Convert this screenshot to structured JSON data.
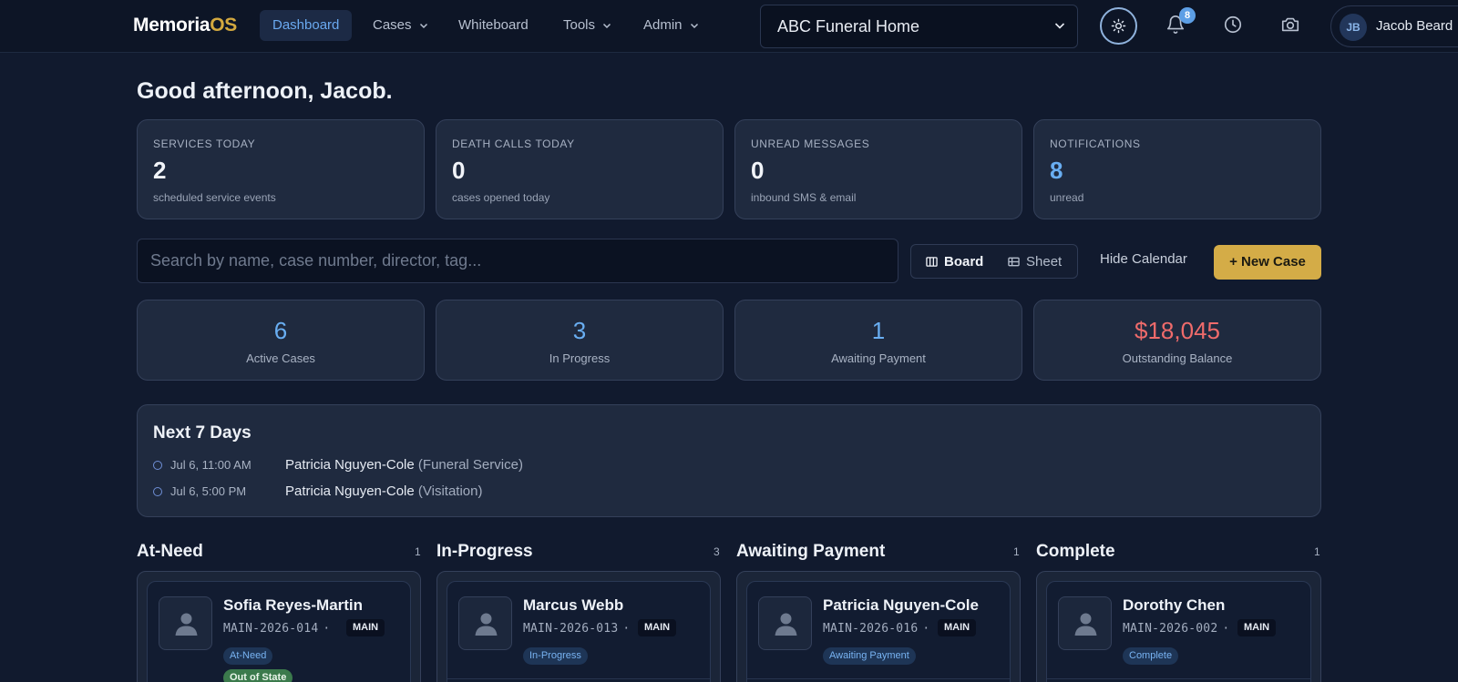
{
  "app": {
    "logo_part1": "Memoria",
    "logo_part2": "OS"
  },
  "nav": {
    "items": [
      {
        "label": "Dashboard",
        "active": true,
        "dropdown": false
      },
      {
        "label": "Cases",
        "active": false,
        "dropdown": true
      },
      {
        "label": "Whiteboard",
        "active": false,
        "dropdown": false
      },
      {
        "label": "Tools",
        "active": false,
        "dropdown": true
      },
      {
        "label": "Admin",
        "active": false,
        "dropdown": true
      }
    ]
  },
  "location_select": {
    "value": "ABC Funeral Home"
  },
  "header": {
    "notification_count": "8",
    "user": {
      "initials": "JB",
      "name": "Jacob Beard"
    }
  },
  "greeting": "Good afternoon, Jacob.",
  "stats": [
    {
      "label": "SERVICES TODAY",
      "value": "2",
      "sub": "scheduled service events"
    },
    {
      "label": "DEATH CALLS TODAY",
      "value": "0",
      "sub": "cases opened today"
    },
    {
      "label": "UNREAD MESSAGES",
      "value": "0",
      "sub": "inbound SMS & email"
    },
    {
      "label": "NOTIFICATIONS",
      "value": "8",
      "sub": "unread"
    }
  ],
  "search": {
    "placeholder": "Search by name, case number, director, tag..."
  },
  "view_toggle": {
    "board_label": "Board",
    "sheet_label": "Sheet"
  },
  "actions": {
    "hide_calendar": "Hide Calendar",
    "new_case": "+ New Case"
  },
  "metrics": [
    {
      "value": "6",
      "label": "Active Cases"
    },
    {
      "value": "3",
      "label": "In Progress"
    },
    {
      "value": "1",
      "label": "Awaiting Payment"
    },
    {
      "value": "$18,045",
      "label": "Outstanding Balance"
    }
  ],
  "next7": {
    "title": "Next 7 Days",
    "events": [
      {
        "when": "Jul 6, 11:00 AM",
        "name": "Patricia Nguyen-Cole",
        "kind": "(Funeral Service)"
      },
      {
        "when": "Jul 6, 5:00 PM",
        "name": "Patricia Nguyen-Cole",
        "kind": "(Visitation)"
      }
    ]
  },
  "columns": [
    {
      "title": "At-Need",
      "count": "1",
      "card": {
        "name": "Sofia Reyes-Martin",
        "number": "MAIN-2026-014",
        "sep": "·",
        "location": "MAIN",
        "status": "At-Need",
        "extra_tag": "Out of State"
      }
    },
    {
      "title": "In-Progress",
      "count": "3",
      "card": {
        "name": "Marcus Webb",
        "number": "MAIN-2026-013",
        "sep": "·",
        "location": "MAIN",
        "status": "In-Progress",
        "extra_tag": ""
      }
    },
    {
      "title": "Awaiting Payment",
      "count": "1",
      "card": {
        "name": "Patricia Nguyen-Cole",
        "number": "MAIN-2026-016",
        "sep": "·",
        "location": "MAIN",
        "status": "Awaiting Payment",
        "extra_tag": ""
      }
    },
    {
      "title": "Complete",
      "count": "1",
      "card": {
        "name": "Dorothy Chen",
        "number": "MAIN-2026-002",
        "sep": "·",
        "location": "MAIN",
        "status": "Complete",
        "extra_tag": ""
      }
    }
  ],
  "colors": {
    "accent": "#69aef2",
    "brand_gold": "#d4ac47",
    "danger": "#ef6b6b",
    "success_tag": "#3b7a4c"
  }
}
